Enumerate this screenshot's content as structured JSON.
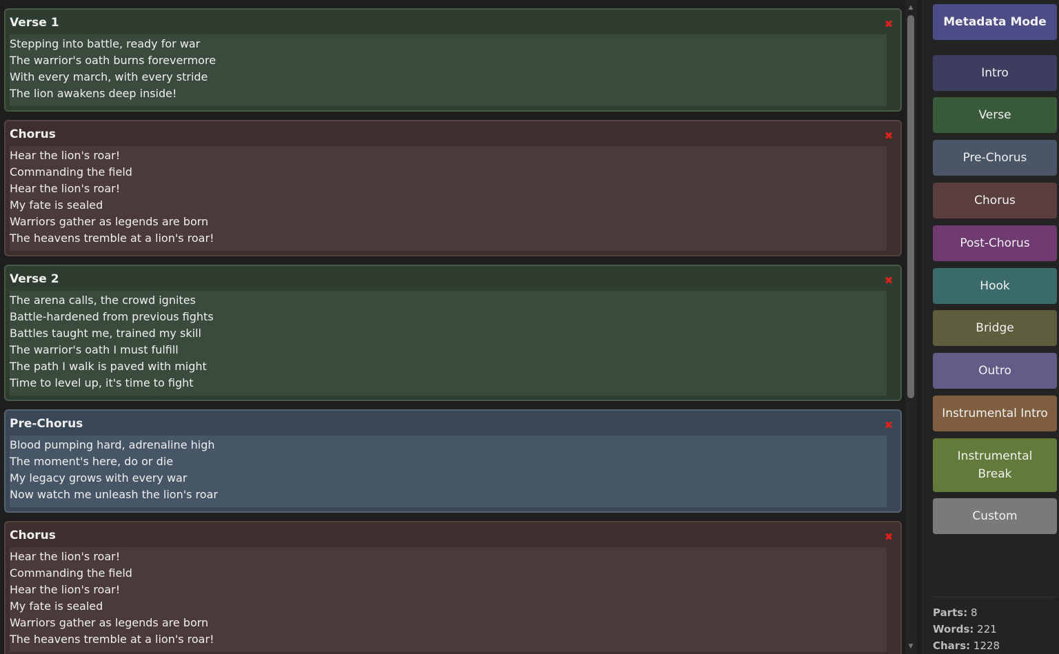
{
  "sections": [
    {
      "title": "Verse 1",
      "type": "verse",
      "lines": [
        "Stepping into battle, ready for war",
        "The warrior's oath burns forevermore",
        "With every march, with every stride",
        "The lion awakens deep inside!"
      ]
    },
    {
      "title": "Chorus",
      "type": "chorus",
      "lines": [
        "Hear the lion's roar!",
        "Commanding the field",
        "Hear the lion's roar!",
        "My fate is sealed",
        "Warriors gather as legends are born",
        "The heavens tremble at a lion's roar!"
      ]
    },
    {
      "title": "Verse 2",
      "type": "verse",
      "lines": [
        "The arena calls, the crowd ignites",
        "Battle-hardened from previous fights",
        "Battles taught me, trained my skill",
        "The warrior's oath I must fulfill",
        "The path I walk is paved with might",
        "Time to level up, it's time to fight"
      ]
    },
    {
      "title": "Pre-Chorus",
      "type": "prechorus",
      "lines": [
        "Blood pumping hard, adrenaline high",
        "The moment's here, do or die",
        "My legacy grows with every war",
        "Now watch me unleash the lion's roar"
      ]
    },
    {
      "title": "Chorus",
      "type": "chorus",
      "lines": [
        "Hear the lion's roar!",
        "Commanding the field",
        "Hear the lion's roar!",
        "My fate is sealed",
        "Warriors gather as legends are born",
        "The heavens tremble at a lion's roar!"
      ]
    }
  ],
  "section_colors": {
    "verse": {
      "outer": "#2e3d30",
      "inner": "#3a4a3c",
      "border": "#465a48"
    },
    "chorus": {
      "outer": "#3e2e2e",
      "inner": "#4a3a3a",
      "border": "#564444"
    },
    "prechorus": {
      "outer": "#3a4756",
      "inner": "#475666",
      "border": "#536374"
    }
  },
  "delete_icon": "close-x-icon",
  "sidebar": {
    "mode_button": {
      "label": "Metadata Mode",
      "color": "#4c4c86"
    },
    "buttons": [
      {
        "label": "Intro",
        "color": "#3d3d60"
      },
      {
        "label": "Verse",
        "color": "#3a5a3c"
      },
      {
        "label": "Pre-Chorus",
        "color": "#4a5666"
      },
      {
        "label": "Chorus",
        "color": "#5a3e3e"
      },
      {
        "label": "Post-Chorus",
        "color": "#6e3a70"
      },
      {
        "label": "Hook",
        "color": "#3a6a6a"
      },
      {
        "label": "Bridge",
        "color": "#5e5e3e"
      },
      {
        "label": "Outro",
        "color": "#645c88"
      },
      {
        "label": "Instrumental Intro",
        "color": "#7e5e3e"
      },
      {
        "label": "Instrumental Break",
        "color": "#627a3a"
      },
      {
        "label": "Custom",
        "color": "#7a7a7a"
      }
    ]
  },
  "stats": {
    "parts_label": "Parts:",
    "parts_value": "8",
    "words_label": "Words:",
    "words_value": "221",
    "chars_label": "Chars:",
    "chars_value": "1228"
  }
}
